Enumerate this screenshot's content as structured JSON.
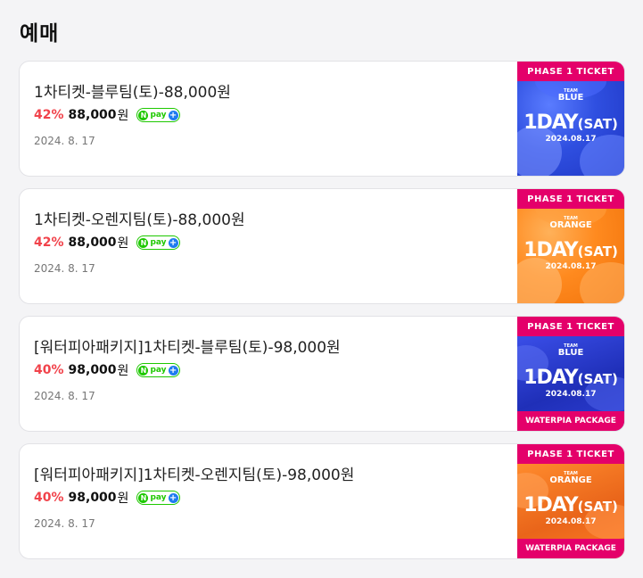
{
  "section": {
    "title": "예매"
  },
  "items": [
    {
      "name": "1차티켓-블루팀(토)-88,000원",
      "discount": "42%",
      "price": "88,000",
      "currency": "원",
      "date": "2024. 8. 17",
      "thumb": {
        "phase": "PHASE 1 TICKET",
        "team_small": "TEAM",
        "team": "BLUE",
        "day": "1DAY",
        "weekday": "(SAT)",
        "date": "2024.08.17",
        "package": "",
        "color": "#2f4fe0"
      }
    },
    {
      "name": "1차티켓-오렌지팀(토)-88,000원",
      "discount": "42%",
      "price": "88,000",
      "currency": "원",
      "date": "2024. 8. 17",
      "thumb": {
        "phase": "PHASE 1 TICKET",
        "team_small": "TEAM",
        "team": "ORANGE",
        "day": "1DAY",
        "weekday": "(SAT)",
        "date": "2024.08.17",
        "package": "",
        "color": "#ff8a1f"
      }
    },
    {
      "name": "[워터피아패키지]1차티켓-블루팀(토)-98,000원",
      "discount": "40%",
      "price": "98,000",
      "currency": "원",
      "date": "2024. 8. 17",
      "thumb": {
        "phase": "PHASE 1 TICKET",
        "team_small": "TEAM",
        "team": "BLUE",
        "day": "1DAY",
        "weekday": "(SAT)",
        "date": "2024.08.17",
        "package": "WATERPIA PACKAGE",
        "color": "#2f4fe0"
      }
    },
    {
      "name": "[워터피아패키지]1차티켓-오렌지팀(토)-98,000원",
      "discount": "40%",
      "price": "98,000",
      "currency": "원",
      "date": "2024. 8. 17",
      "thumb": {
        "phase": "PHASE 1 TICKET",
        "team_small": "TEAM",
        "team": "ORANGE",
        "day": "1DAY",
        "weekday": "(SAT)",
        "date": "2024.08.17",
        "package": "WATERPIA PACKAGE",
        "color": "#ff8a1f"
      }
    }
  ],
  "npay": {
    "n": "N",
    "pay": "pay",
    "plus": "+"
  },
  "colors": {
    "discount": "#f1434b",
    "npay_green": "#1ec800",
    "ticket_pink": "#e4006a"
  }
}
